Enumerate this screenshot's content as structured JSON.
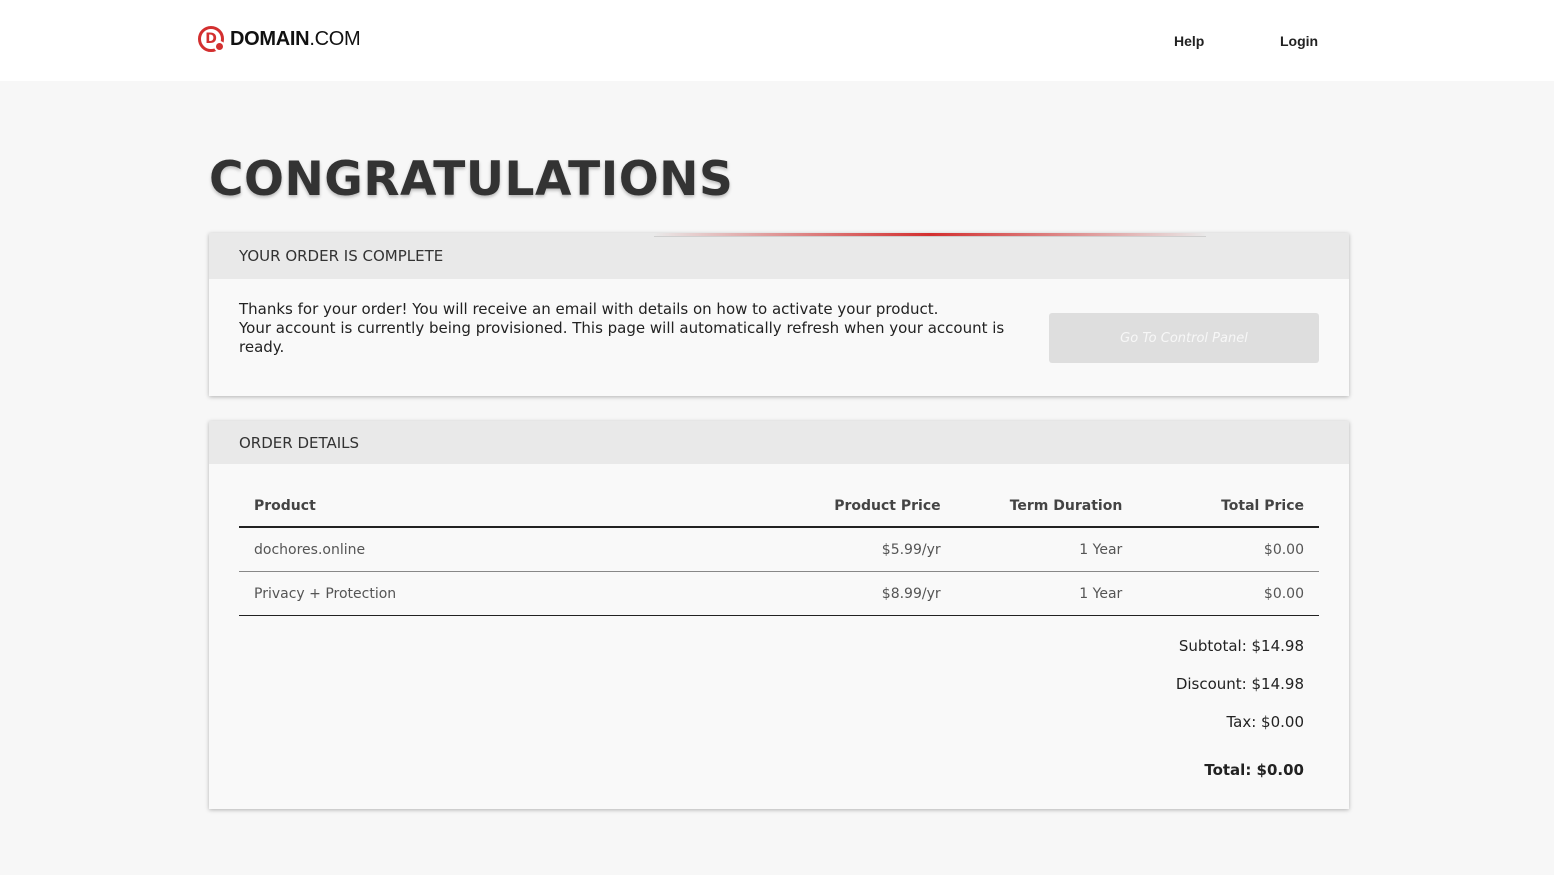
{
  "header": {
    "logo_text": "DOMAIN",
    "logo_suffix": ".COM",
    "logo_letter": "D",
    "nav": {
      "help": "Help",
      "login": "Login"
    }
  },
  "page_title": "CONGRATULATIONS",
  "order_complete": {
    "heading": "YOUR ORDER IS COMPLETE",
    "line1": "Thanks for your order! You will receive an email with details on how to activate your product.",
    "line2": "Your account is currently being provisioned. This page will automatically refresh when your account is ready.",
    "button_label": "Go To Control Panel"
  },
  "order_details": {
    "heading": "ORDER DETAILS",
    "columns": [
      "Product",
      "Product Price",
      "Term Duration",
      "Total Price"
    ],
    "rows": [
      {
        "product": "dochores.online",
        "price": "$5.99/yr",
        "term": "1 Year",
        "total": "$0.00"
      },
      {
        "product": "Privacy + Protection",
        "price": "$8.99/yr",
        "term": "1 Year",
        "total": "$0.00"
      }
    ],
    "subtotal": "Subtotal: $14.98",
    "discount": "Discount: $14.98",
    "tax": "Tax: $0.00",
    "total": "Total: $0.00"
  },
  "colors": {
    "brand": "#d32f2f",
    "header_bg": "#e9e9e9",
    "page_bg": "#f7f7f7"
  }
}
